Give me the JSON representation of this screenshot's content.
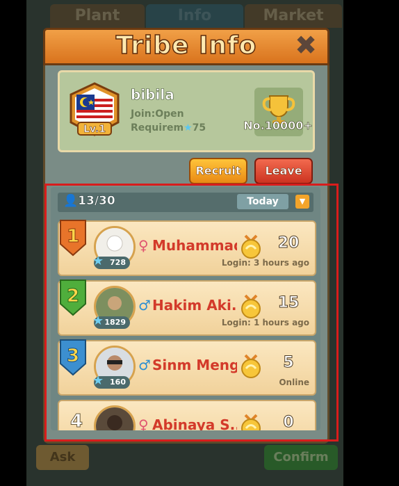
{
  "background": {
    "tabs": [
      "Plant",
      "Info",
      "Market"
    ],
    "bottom_buttons": [
      "Ask",
      "Confirm"
    ]
  },
  "dialog": {
    "title": "Tribe Info",
    "close_icon": "close-icon"
  },
  "tribe": {
    "name": "bibila",
    "level": "Lv.1",
    "join": "Join:Open",
    "requirement_label": "Requirem",
    "requirement_value": "75",
    "rank_label": "No.10000+",
    "flag": "malaysia-flag-icon"
  },
  "buttons": {
    "recruit": "Recruit",
    "leave": "Leave"
  },
  "members": {
    "count": "13/30",
    "filter": "Today",
    "list": [
      {
        "rank": "1",
        "rank_color": "#e8742a",
        "gender": "♀",
        "gender_type": "f",
        "name": "Muhammad",
        "power": "728",
        "score": "20",
        "status": "Login: 3 hours ago"
      },
      {
        "rank": "2",
        "rank_color": "#4fae3c",
        "gender": "♂",
        "gender_type": "m",
        "name": "Hakim Aki...",
        "power": "1829",
        "score": "15",
        "status": "Login: 1 hours ago"
      },
      {
        "rank": "3",
        "rank_color": "#3c8fd0",
        "gender": "♂",
        "gender_type": "m",
        "name": "Sinm Meng",
        "power": "160",
        "score": "5",
        "status": "Online"
      },
      {
        "rank": "4",
        "rank_color": "#cfc2a8",
        "gender": "♀",
        "gender_type": "f",
        "name": "Abinaya S...",
        "power": "",
        "score": "0",
        "status": ""
      }
    ]
  }
}
